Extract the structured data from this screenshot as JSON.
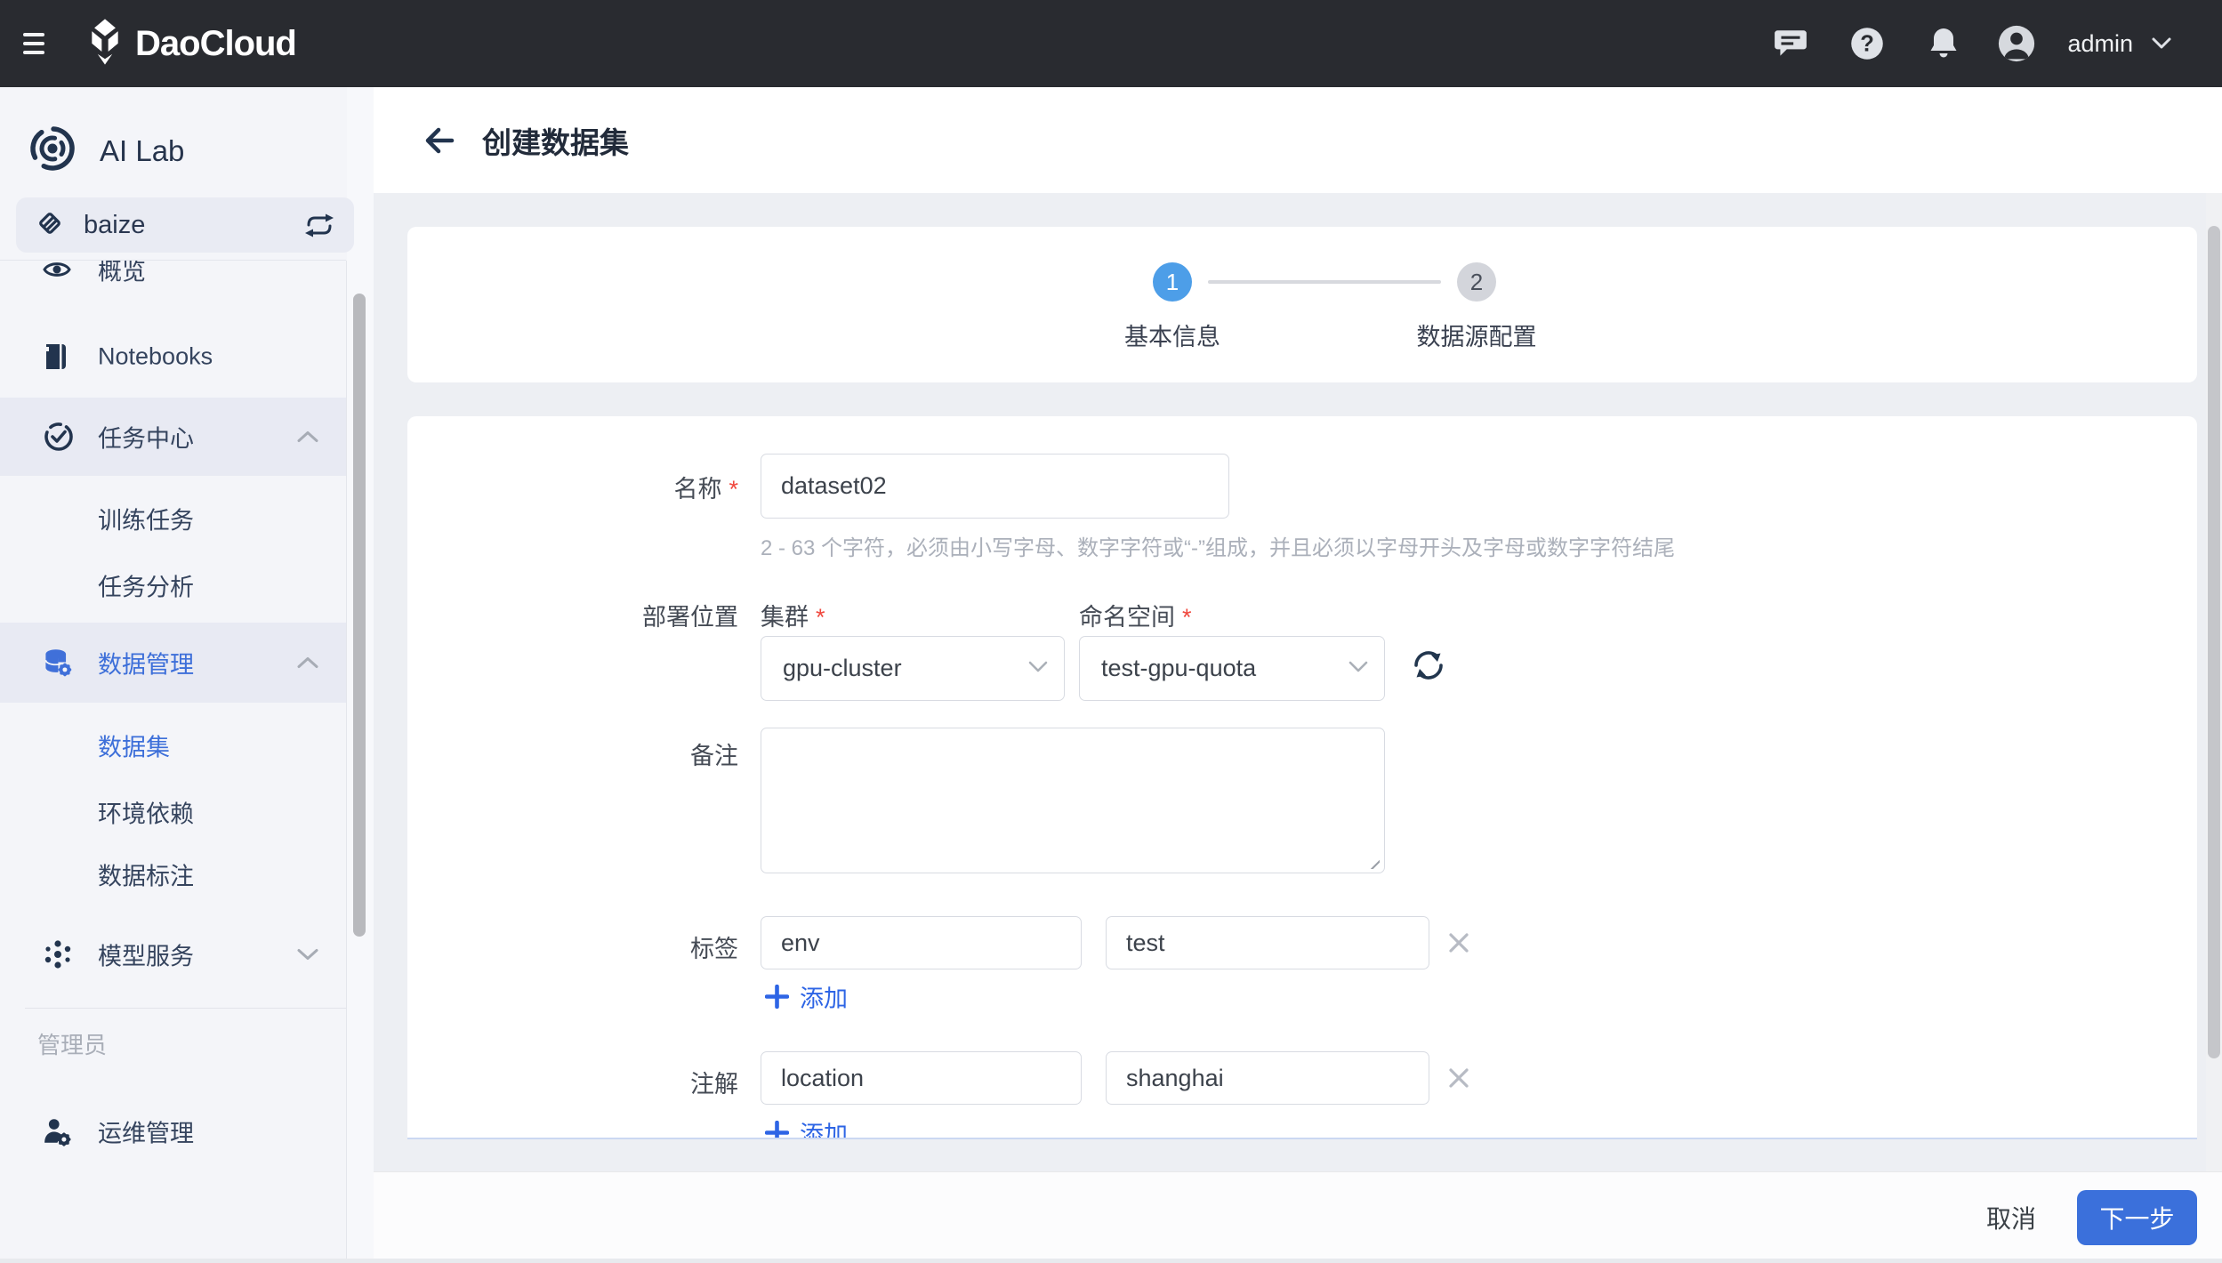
{
  "topbar": {
    "brand": "DaoCloud",
    "user": "admin"
  },
  "sidebar": {
    "product": "AI Lab",
    "workspace": "baize",
    "items": [
      {
        "label": "概览"
      },
      {
        "label": "Notebooks"
      },
      {
        "label": "任务中心"
      },
      {
        "label": "训练任务"
      },
      {
        "label": "任务分析"
      },
      {
        "label": "数据管理"
      },
      {
        "label": "数据集"
      },
      {
        "label": "环境依赖"
      },
      {
        "label": "数据标注"
      },
      {
        "label": "模型服务"
      }
    ],
    "admin_section": "管理员",
    "ops_item": "运维管理"
  },
  "page": {
    "title": "创建数据集"
  },
  "stepper": {
    "steps": [
      {
        "num": "1",
        "label": "基本信息"
      },
      {
        "num": "2",
        "label": "数据源配置"
      }
    ]
  },
  "form": {
    "required": "*",
    "name_label": "名称",
    "name_value": "dataset02",
    "name_hint": "2 - 63 个字符，必须由小写字母、数字字符或“-”组成，并且必须以字母开头及字母或数字字符结尾",
    "deploy_label": "部署位置",
    "cluster_label": "集群",
    "cluster_value": "gpu-cluster",
    "namespace_label": "命名空间",
    "namespace_value": "test-gpu-quota",
    "remark_label": "备注",
    "tags_label": "标签",
    "tag_key": "env",
    "tag_value": "test",
    "annotations_label": "注解",
    "annotation_key": "location",
    "annotation_value": "shanghai",
    "add_label": "添加"
  },
  "footer": {
    "cancel": "取消",
    "next": "下一步"
  },
  "colors": {
    "primary": "#3B70DB",
    "step_active": "#4D9EE8",
    "link": "#2E65E5",
    "sidebar_active": "#3D6FD9",
    "topbar_bg": "#292B30"
  }
}
